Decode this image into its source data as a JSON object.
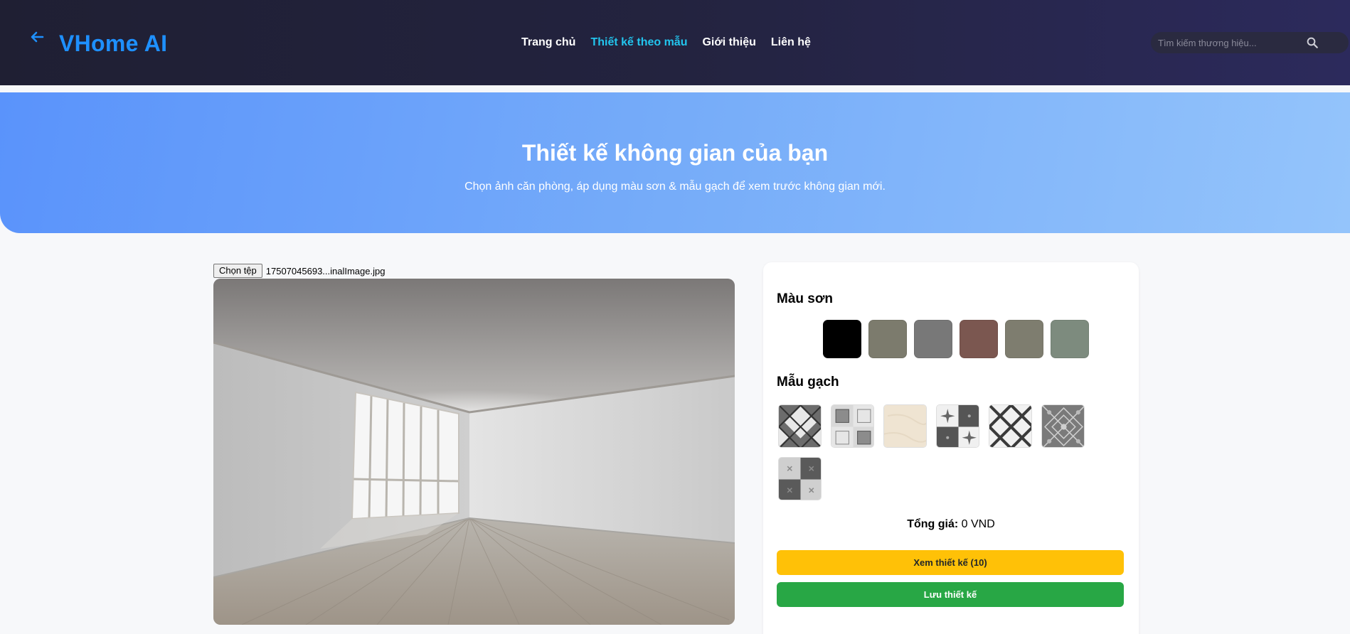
{
  "header": {
    "brand": "VHome AI",
    "nav": [
      "Trang chủ",
      "Thiết kế theo mẫu",
      "Giới thiệu",
      "Liên hệ"
    ],
    "active_nav": "Thiết kế theo mẫu",
    "search_placeholder": "Tìm kiếm thương hiệu..."
  },
  "hero": {
    "title": "Thiết kế không gian của bạn",
    "subtitle": "Chọn ảnh căn phòng, áp dụng màu sơn & mẫu gạch để xem trước không gian mới."
  },
  "upload": {
    "button_label": "Chọn tệp",
    "file_name": "17507045693...inalImage.jpg"
  },
  "panel": {
    "paint_title": "Màu sơn",
    "paint_colors": [
      "#000000",
      "#7c7b6d",
      "#787878",
      "#7b5750",
      "#7e7d6f",
      "#7d8b7e"
    ],
    "tile_title": "Mẫu gạch",
    "tile_patterns": [
      "diamond-checker",
      "square-inlay",
      "cream-plain",
      "flower-checker",
      "diagonal-lattice",
      "grey-ornament",
      "grey-checker"
    ],
    "total_label": "Tổng giá:",
    "total_value": "0 VND",
    "view_button": "Xem thiết kế (10)",
    "save_button": "Lưu thiết kế"
  },
  "colors": {
    "brand": "#1e90ff",
    "active_nav": "#22c5ee",
    "view_button": "#ffc107",
    "save_button": "#28a745"
  }
}
